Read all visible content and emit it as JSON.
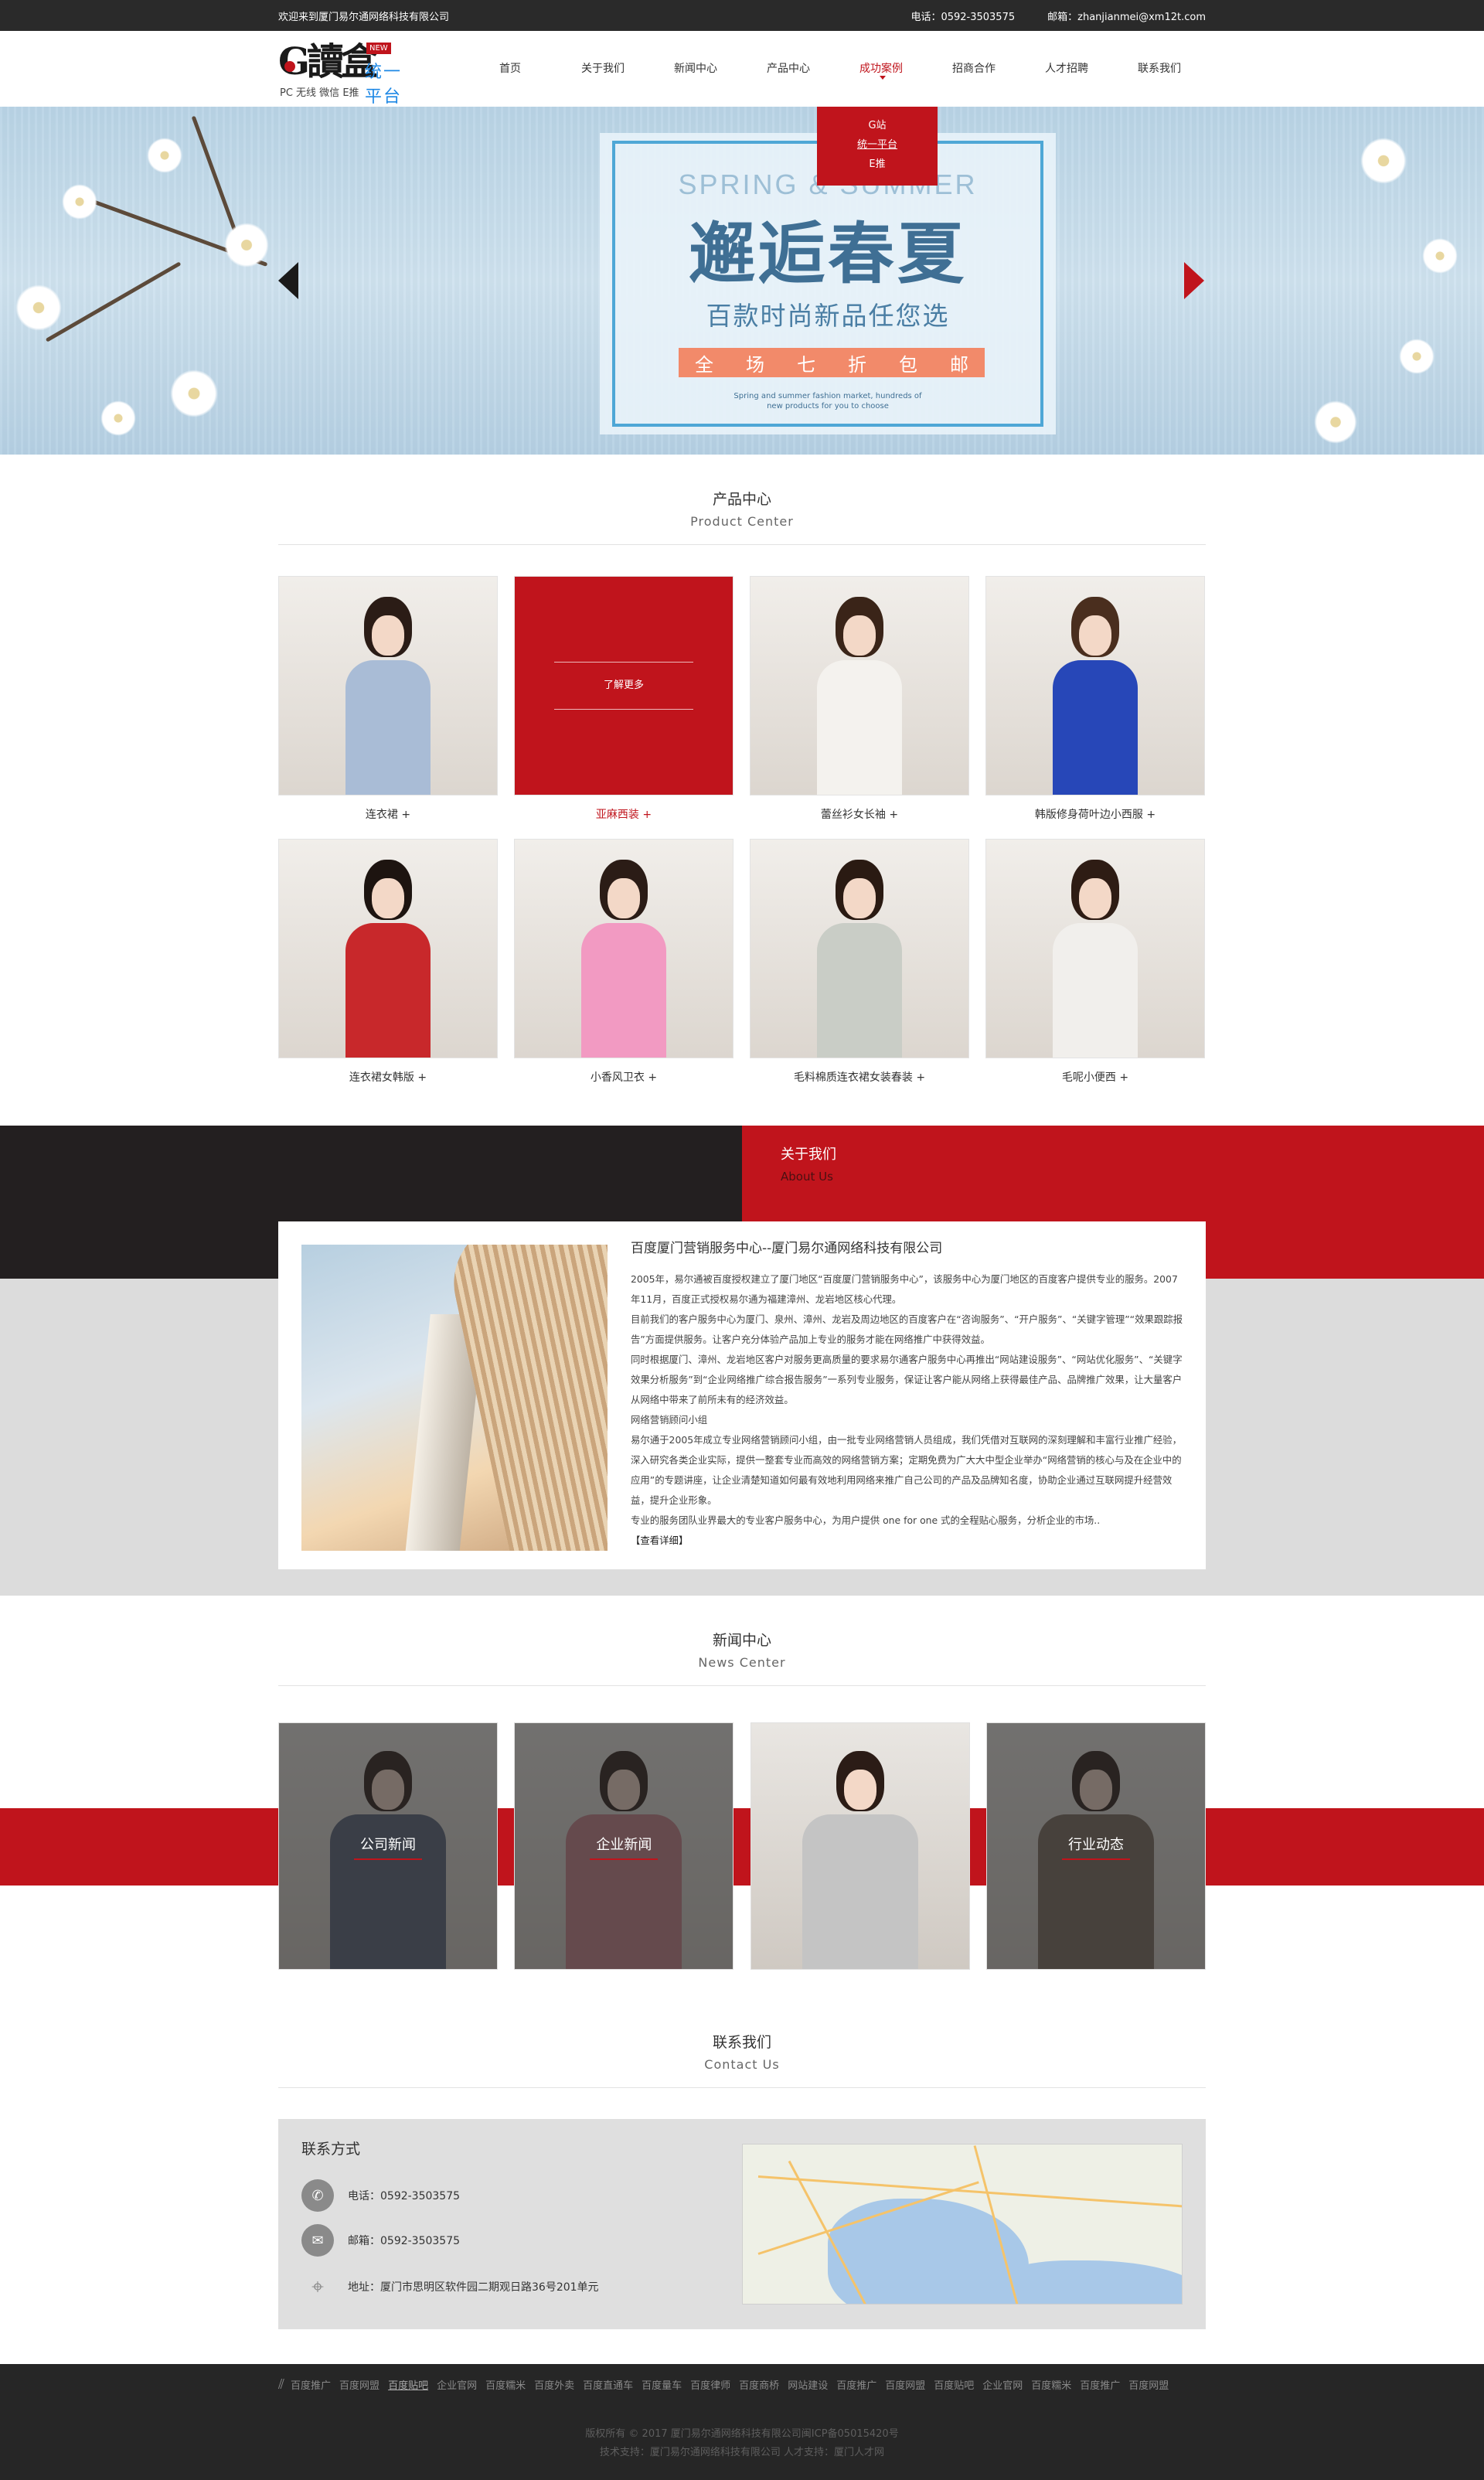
{
  "topbar": {
    "welcome": "欢迎来到厦门易尔通网络科技有限公司",
    "phone": "电话：0592-3503575",
    "email": "邮箱：zhanjianmei@xm12t.com"
  },
  "logo": {
    "mark": "G讀盒",
    "new_tag": "NEW",
    "brand": "统一平台",
    "sub": "PC 无线  微信  E推"
  },
  "nav": [
    "首页",
    "关于我们",
    "新闻中心",
    "产品中心",
    "成功案例",
    "招商合作",
    "人才招聘",
    "联系我们"
  ],
  "nav_active": "成功案例",
  "dropdown": [
    "G站",
    "统一平台",
    "E推"
  ],
  "banner": {
    "en": "SPRING & SUMMER",
    "zh": "邂逅春夏",
    "zh2": "百款时尚新品任您选",
    "sale": [
      "全",
      "场",
      "七",
      "折",
      "包",
      "邮"
    ],
    "tiny1": "Spring and summer fashion market, hundreds of",
    "tiny2": "new products for you to choose"
  },
  "products": {
    "cn": "产品中心",
    "en": "Product Center",
    "learn_more": "了解更多",
    "items": [
      {
        "name": "连衣裙 +",
        "hair": "#2b1c16",
        "top": "#a9bcd6"
      },
      {
        "name": "亚麻西装 +",
        "hair": "#2b1c16",
        "top": "#c0141c"
      },
      {
        "name": "蕾丝衫女长袖 +",
        "hair": "#3a2418",
        "top": "#f4f2ee"
      },
      {
        "name": "韩版修身荷叶边小西服 +",
        "hair": "#4a2e1e",
        "top": "#2747b8"
      },
      {
        "name": "连衣裙女韩版 +",
        "hair": "#1d1410",
        "top": "#c8282b"
      },
      {
        "name": "小香风卫衣 +",
        "hair": "#2b1c16",
        "top": "#f29ac2"
      },
      {
        "name": "毛料棉质连衣裙女装春装 +",
        "hair": "#2a1a12",
        "top": "#c9cdc6"
      },
      {
        "name": "毛呢小便西 +",
        "hair": "#2e1c14",
        "top": "#f1efec"
      }
    ]
  },
  "about": {
    "cn": "关于我们",
    "en": "About Us",
    "title": "百度厦门营销服务中心--厦门易尔通网络科技有限公司",
    "p1": " 2005年，易尔通被百度授权建立了厦门地区“百度厦门营销服务中心”，该服务中心为厦门地区的百度客户提供专业的服务。2007年11月，百度正式授权易尔通为福建漳州、龙岩地区核心代理。",
    "p2": "目前我们的客户服务中心为厦门、泉州、漳州、龙岩及周边地区的百度客户在“咨询服务”、“开户服务”、“关键字管理”“效果跟踪报告”方面提供服务。让客户充分体验产品加上专业的服务才能在网络推广中获得效益。",
    "p3": "同时根据厦门、漳州、龙岩地区客户对服务更高质量的要求易尔通客户服务中心再推出“网站建设服务”、“网站优化服务”、“关键字效果分析服务”到“企业网络推广综合报告服务”一系列专业服务，保证让客户能从网络上获得最佳产品、品牌推广效果，让大量客户从网络中带来了前所未有的经济效益。",
    "p4": "网络营销顾问小组",
    "p5": "易尔通于2005年成立专业网络营销顾问小组，由一批专业网络营销人员组成，我们凭借对互联网的深刻理解和丰富行业推广经验，深入研究各类企业实际，提供一整套专业而高效的网络营销方案；定期免费为广大大中型企业举办“网络营销的核心与及在企业中的应用”的专题讲座，让企业清楚知道如何最有效地利用网络来推广自己公司的产品及品牌知名度，协助企业通过互联网提升经营效益，提升企业形象。",
    "p6": "专业的服务团队业界最大的专业客户服务中心，为用户提供 one for one 式的全程贴心服务，分析企业的市场..",
    "more": "【查看详细】"
  },
  "news": {
    "cn": "新闻中心",
    "en": "News Center",
    "cards": [
      {
        "label": "公司新闻",
        "top": "#57637a"
      },
      {
        "label": "企业新闻",
        "top": "#c7828a"
      },
      {
        "label": "",
        "top": "#c4c4c4"
      },
      {
        "label": "行业动态",
        "top": "#7a6a5d"
      }
    ]
  },
  "contact": {
    "cn": "联系我们",
    "en": "Contact Us",
    "title": "联系方式",
    "phone": "电话：0592-3503575",
    "email": "邮箱：0592-3503575",
    "address": "地址：厦门市思明区软件园二期观日路36号201单元"
  },
  "footer": {
    "links": [
      "百度推广",
      "百度网盟",
      "百度贴吧",
      "企业官网",
      "百度糯米",
      "百度外卖",
      "百度直通车",
      "百度量车",
      "百度律师",
      "百度商桥",
      "网站建设",
      "百度推广",
      "百度网盟",
      "百度贴吧",
      "企业官网",
      "百度糯米",
      "百度推广",
      "百度网盟"
    ],
    "copy1": "版权所有 © 2017 厦门易尔通网络科技有限公司闽ICP备05015420号",
    "copy2": "技术支持：厦门易尔通网络科技有限公司   人才支持：厦门人才网"
  }
}
